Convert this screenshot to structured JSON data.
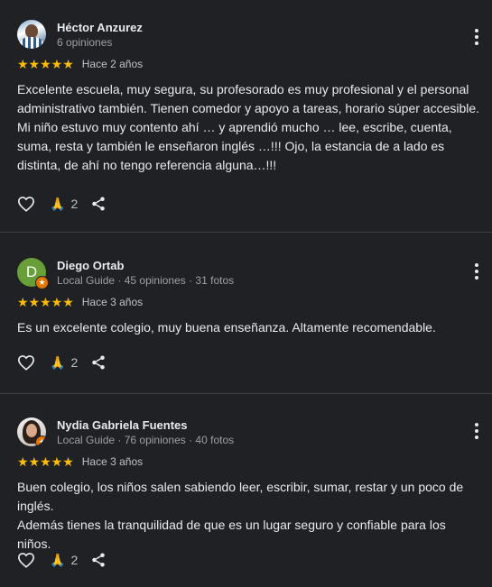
{
  "reviews": [
    {
      "name": "Héctor Anzurez",
      "meta": "6 opiniones",
      "stars": "★★★★★",
      "time": "Hace 2 años",
      "text": "Excelente escuela, muy segura, su profesorado es muy profesional y el personal administrativo también. Tienen comedor y apoyo a tareas, horario súper accesible. Mi niño estuvo muy contento ahí … y aprendió mucho … lee, escribe, cuenta, suma, resta y también le enseñaron inglés …!!! Ojo, la estancia de a lado es distinta, de ahí no tengo referencia alguna…!!!",
      "thanks_count": "2"
    },
    {
      "name": "Diego Ortab",
      "avatar_letter": "D",
      "meta": "Local Guide · 45 opiniones · 31 fotos",
      "stars": "★★★★★",
      "time": "Hace 3 años",
      "text": "Es un excelente colegio, muy buena enseñanza. Altamente recomendable.",
      "thanks_count": "2"
    },
    {
      "name": "Nydia Gabriela Fuentes",
      "meta": "Local Guide · 76 opiniones · 40 fotos",
      "stars": "★★★★★",
      "time": "Hace 3 años",
      "text_line1": "Buen colegio, los niños salen sabiendo leer, escribir, sumar, restar y un poco de inglés.",
      "text_line2": "Además tienes la tranquilidad de que es un lugar seguro y confiable para los niños.",
      "thanks_count": "2"
    }
  ],
  "icons": {
    "like": "heart-outline-icon",
    "thanks": "pray-hands-emoji",
    "share": "share-icon",
    "more": "three-dots-vertical-icon",
    "local_guide_badge": "star-badge-icon"
  },
  "colors": {
    "background": "#202124",
    "star": "#fbbc04",
    "divider": "#3c4043",
    "avatar_green": "#689f38",
    "guide_badge": "#e37400"
  }
}
